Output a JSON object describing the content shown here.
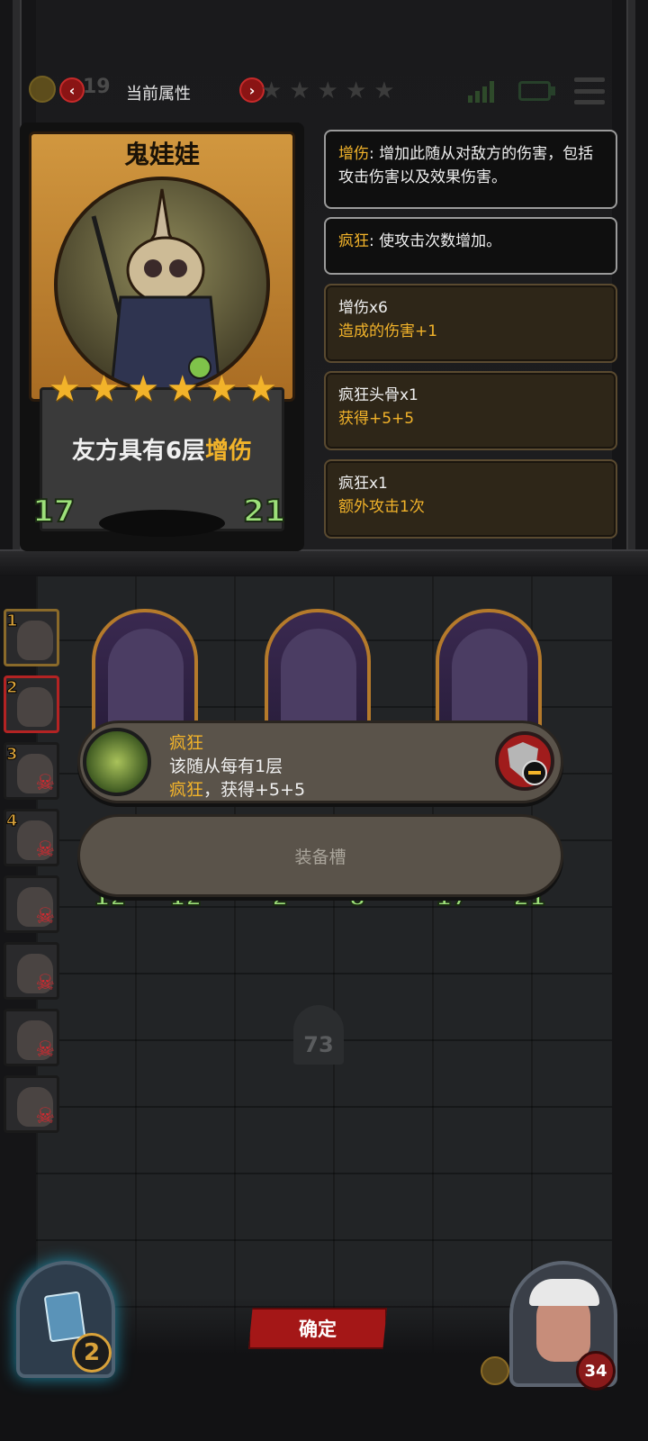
{
  "topbar": {
    "title": "当前属性",
    "coin_text": "19",
    "stars_count": 5
  },
  "card": {
    "name": "鬼娃娃",
    "stars": 6,
    "desc_prefix": "友方具有6层",
    "desc_keyword": "增伤",
    "attack": "17",
    "health": "21"
  },
  "info_panels": [
    {
      "keyword": "增伤",
      "text": ": 增加此随从对敌方的伤害，包括攻击伤害以及效果伤害。"
    },
    {
      "keyword": "疯狂",
      "text": ": 使攻击次数增加。"
    }
  ],
  "effect_panels": [
    {
      "title": "增伤x6",
      "detail": "造成的伤害+1"
    },
    {
      "title": "疯狂头骨x1",
      "detail": "获得+5+5"
    },
    {
      "title": "疯狂x1",
      "detail": "额外攻击1次"
    }
  ],
  "team_slots": [
    {
      "num": "1",
      "dead": false
    },
    {
      "num": "2",
      "dead": false
    },
    {
      "num": "3",
      "dead": true
    },
    {
      "num": "4",
      "dead": true
    },
    {
      "num": "",
      "dead": true
    },
    {
      "num": "",
      "dead": true
    },
    {
      "num": "",
      "dead": true
    },
    {
      "num": "",
      "dead": true
    }
  ],
  "board_minions": [
    {
      "atk": "12",
      "hp": "12"
    },
    {
      "atk": "2",
      "hp": "8"
    },
    {
      "atk": "17",
      "hp": "21"
    }
  ],
  "tooltip": {
    "title": "疯狂",
    "line2": "该随从每有1层",
    "line3_keyword": "疯狂",
    "line3_text": "，获得+5+5"
  },
  "equip_slot": {
    "label": "装备槽"
  },
  "turn": {
    "number": "73"
  },
  "bottom": {
    "confirm_label": "确定",
    "deck_count": "2",
    "hero_hp": "34"
  },
  "colors": {
    "keyword": "#f2b32a",
    "stat_green": "#9de07a",
    "confirm_red": "#a41717"
  }
}
